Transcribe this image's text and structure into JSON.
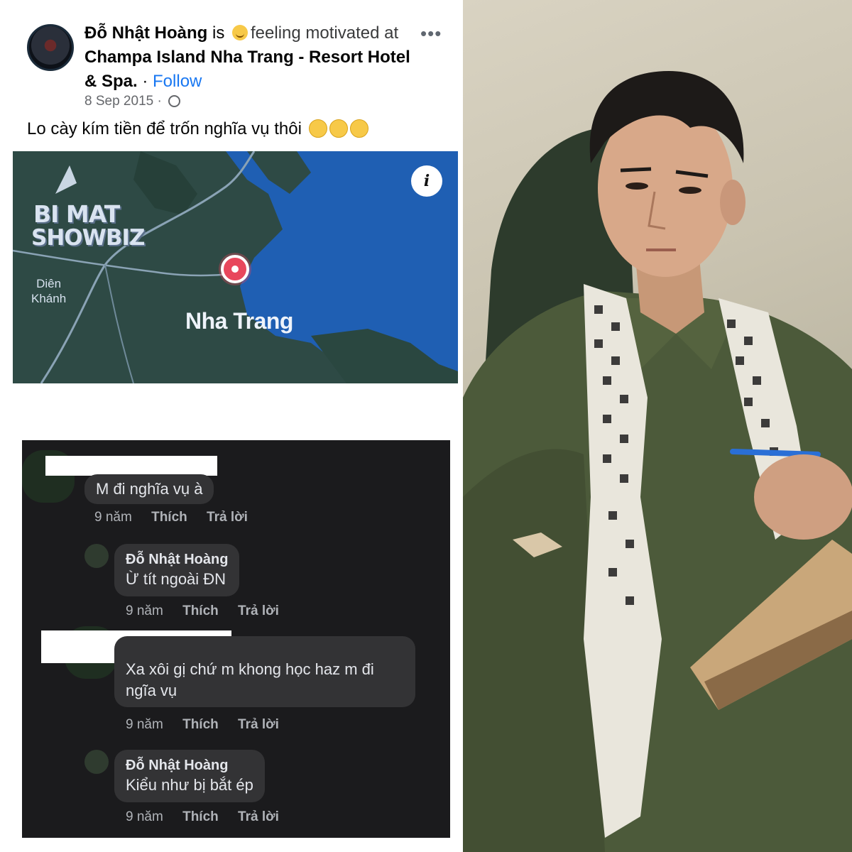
{
  "post": {
    "author": "Đỗ Nhật Hoàng",
    "is_text": "is",
    "feeling_text": "feeling motivated",
    "at_text": "at",
    "place": "Champa Island Nha Trang - Resort Hotel & Spa.",
    "separator": " · ",
    "follow_label": "Follow",
    "more_label": "•••",
    "date": "8 Sep 2015",
    "date_separator": " · ",
    "caption": "Lo cày kím tiền để trốn nghĩa vụ thôi"
  },
  "map": {
    "info_label": "i",
    "watermark_line1": "BI MAT",
    "watermark_line2": "SHOWBIZ",
    "label_small_line1": "Diên",
    "label_small_line2": "Khánh",
    "label_big": "Nha Trang",
    "water_color": "#1f5fb3",
    "land_color": "#2e4a45"
  },
  "comments": [
    {
      "name": "",
      "text": "M đi nghĩa vụ à",
      "time": "9 năm",
      "like": "Thích",
      "reply": "Trả lời"
    },
    {
      "name": "Đỗ Nhật Hoàng",
      "text": "Ừ tít ngoài ĐN",
      "time": "9 năm",
      "like": "Thích",
      "reply": "Trả lời"
    },
    {
      "name": "",
      "text_line1": "Xa xôi gị chứ m khong học haz m đi",
      "text_line2": "ngĩa vụ",
      "time": "9 năm",
      "like": "Thích",
      "reply": "Trả lời"
    },
    {
      "name": "Đỗ Nhật Hoàng",
      "text": "Kiểu như bị bắt ép",
      "time": "9 năm",
      "like": "Thích",
      "reply": "Trả lời"
    }
  ],
  "colors": {
    "follow": "#1877f2",
    "comments_bg": "#1b1b1d",
    "bubble_bg": "#333335"
  }
}
